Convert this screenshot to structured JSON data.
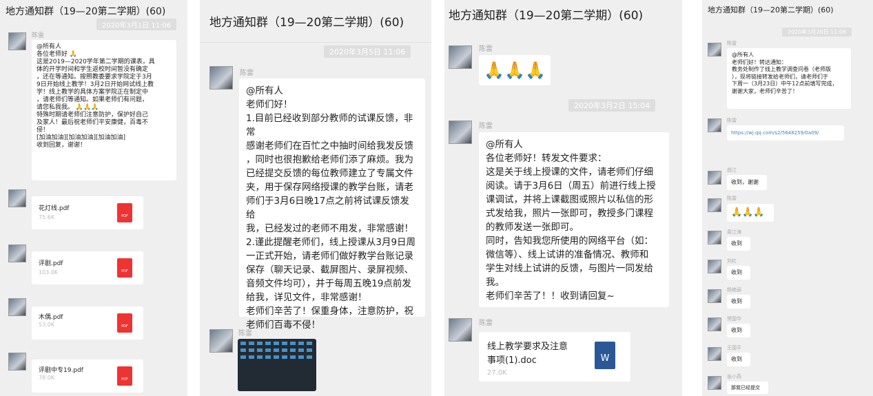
{
  "panel1": {
    "title": "地方通知群（19—20第二学期）(60)",
    "timestamp": "2020年3月1日 11:06",
    "sender": "陈雷",
    "message_lines": [
      "@所有人",
      "各位老师好",
      "这是2019—2020学年第二学期的课表，具",
      "体的开学时间和学生返校时间暂没有确定",
      "，还在等通知。按照教委要求学院定于3月",
      "9日开始线上教学！3月2日开始网试线上教",
      "学！线上教学的具体方案学院正在制定中",
      "，请老师们等通知。如果老师们有问题，",
      "请您私我我。",
      "特殊时期请老师们注意防护，保护好自己",
      "及家人！最后祝老师们平安康健，百毒不",
      "侵！",
      "[加油加油][加油加油][加油加油]",
      "收到回复，谢谢！"
    ],
    "files": [
      {
        "name": "花灯线.pdf",
        "size": "75.6K"
      },
      {
        "name": "评剧.pdf",
        "size": "103.0K"
      },
      {
        "name": "木偶.pdf",
        "size": "53.0K"
      },
      {
        "name": "评剧中专19.pdf",
        "size": "78.0K"
      }
    ]
  },
  "panel2": {
    "title": "地方通知群（19—20第二学期）(60)",
    "timestamp": "2020年3月5日 11:06",
    "sender1": "陈雷",
    "message_lines": [
      "@所有人",
      "老师们好！",
      "1.目前已经收到部分教师的试课反馈，非常",
      "感谢老师们在百忙之中抽时间给我发反馈",
      "，同时也很抱歉给老师们添了麻烦。我为",
      "已经提交反馈的每位教师建立了专属文件",
      "夹，用于保存网络授课的教学台账，请老",
      "师们于3月6日晚17点之前将试课反馈发给",
      "我，已经发过的老师不用发，非常感谢！",
      "2.谨此提醒老师们，线上授课从3月9日周",
      "一正式开始，请老师们做好教学台账记录",
      "保存（聊天记录、截屏图片、录屏视频、",
      "音频文件均可），并于每周五晚19点前发",
      "给我，详见文件，非常感谢！",
      "老师们辛苦了！保重身体，注意防护，祝",
      "老师们百毒不侵！"
    ],
    "sender2": "陈雷"
  },
  "panel3": {
    "title": "地方通知群（19—20第二学期）(60)",
    "sender1": "陈雷",
    "emoji_text": "🙏🙏🙏",
    "timestamp": "2020年3月2日 15:04",
    "sender2": "陈雷",
    "message_lines": [
      "@所有人",
      "各位老师好！转发文件要求：",
      "这是关于线上授课的文件，请老师们仔细",
      "阅读。请于3月6日（周五）前进行线上授",
      "课调试，并将上课截图或照片以私信的形",
      "式发给我，照片一张即可，教授多门课程",
      "的教师发送一张即可。",
      "同时，告知我您所使用的网络平台（如：",
      "微信等）、线上试讲的准备情况、教师和",
      "学生对线上试讲的反馈，与图片一同发给",
      "我。",
      "老师们辛苦了！！收到请回复~"
    ],
    "sender3": "陈雷",
    "file": {
      "name_line1": "线上教学要求及注意",
      "name_line2": "事项(1).doc",
      "size": "27.0K",
      "icon_label": "W"
    }
  },
  "panel4": {
    "title": "地方通知群（19—20第二学期）(60)",
    "timestamp": "2020年3月20日 11:06",
    "sender1": "陈雷",
    "message_lines": [
      "@所有人",
      "老师们好！转达通知：",
      "教务处制作了线上教学调查问卷（老师版",
      "），现将链接转发给老师们，请老师们于",
      "下周一（3月23日）中午12点前填写完成，",
      "谢谢大家，老师们辛苦了！"
    ],
    "sender2": "陈雷",
    "link": "https://wj.qq.com/s2/5648259/0a09/",
    "replies": [
      {
        "sender": "曲江",
        "text": "收到，谢谢"
      },
      {
        "sender": "陈雷",
        "text": "🙏🙏🙏"
      },
      {
        "sender": "周江涛",
        "text": "收到"
      },
      {
        "sender": "刘红",
        "text": "收到"
      },
      {
        "sender": "杨艳丽",
        "text": "收到"
      },
      {
        "sender": "贺国华",
        "text": "收到"
      },
      {
        "sender": "王国平",
        "text": "收到"
      },
      {
        "sender": "张小燕",
        "text": "那我已经提交"
      }
    ]
  }
}
